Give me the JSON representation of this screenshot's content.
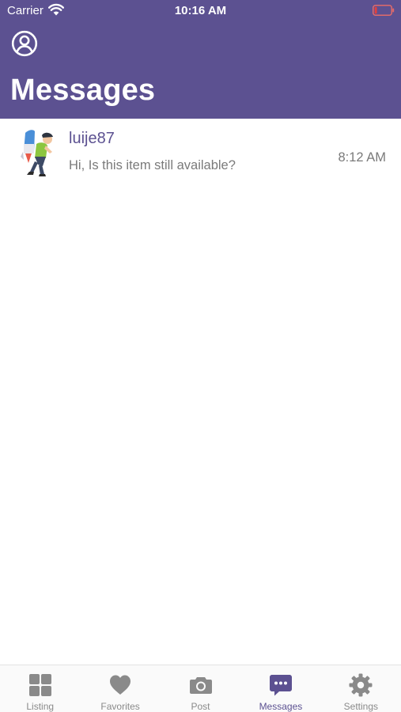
{
  "status_bar": {
    "carrier": "Carrier",
    "time": "10:16 AM"
  },
  "header": {
    "title": "Messages",
    "background_color": "#5c5191",
    "profile_icon": "person-circle-icon"
  },
  "messages": [
    {
      "sender": "luije87",
      "preview": "Hi, Is this item still available?",
      "time": "8:12 AM",
      "avatar": "user-avatar"
    }
  ],
  "tab_bar": {
    "active_color": "#5c5191",
    "inactive_color": "#8a8a8a",
    "tabs": [
      {
        "label": "Listing",
        "icon": "grid-icon",
        "active": false
      },
      {
        "label": "Favorites",
        "icon": "heart-icon",
        "active": false
      },
      {
        "label": "Post",
        "icon": "camera-icon",
        "active": false
      },
      {
        "label": "Messages",
        "icon": "chat-bubble-icon",
        "active": true
      },
      {
        "label": "Settings",
        "icon": "gear-icon",
        "active": false
      }
    ]
  }
}
